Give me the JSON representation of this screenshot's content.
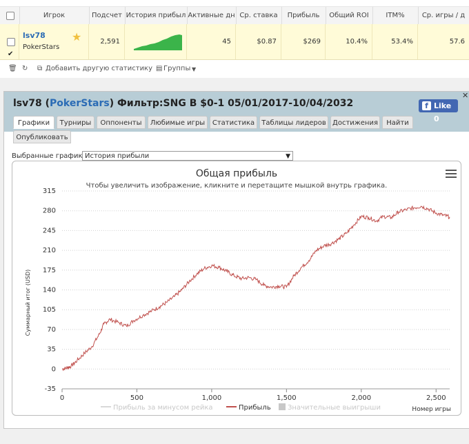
{
  "table": {
    "headers": [
      "Игрок",
      "Подсчет",
      "История прибыл",
      "Активные дн",
      "Ср. ставка",
      "Прибыль",
      "Общий ROI",
      "ITM%",
      "Ср. игры / д"
    ],
    "row": {
      "checked": true,
      "name": "lsv78",
      "site": "PokerStars",
      "count": "2,591",
      "active_days": "45",
      "avg_stake": "$0.87",
      "profit": "$269",
      "roi": "10.4%",
      "itm": "53.4%",
      "avg_games": "57.6"
    },
    "toolbar": {
      "add_label": "Добавить другую статистику",
      "groups_label": "Группы"
    }
  },
  "panel": {
    "title_player": "lsv78",
    "title_site": "PokerStars",
    "title_filter": "Фильтр:SNG B $0-1 05/01/2017-10/04/2032",
    "like_label": "Like 0",
    "tabs": [
      "Графики",
      "Турниры",
      "Оппоненты",
      "Любимые игры",
      "Статистика",
      "Таблицы лидеров",
      "Достижения",
      "Найти",
      "Опубликовать"
    ],
    "active_tab": "Графики",
    "select_label": "Выбранные графики:",
    "select_value": "История прибыли"
  },
  "chart_data": {
    "type": "line",
    "title": "Общая прибыль",
    "subtitle": "Чтобы увеличить изображение, кликните и перетащите мышкой внутрь графика.",
    "ylabel": "Суммарный итог (USD)",
    "xlabel": "Номер игры",
    "ylim": [
      -35,
      315
    ],
    "xlim": [
      0,
      2591
    ],
    "yticks": [
      -35,
      0,
      35,
      70,
      105,
      140,
      175,
      210,
      245,
      280,
      315
    ],
    "xticks": [
      0,
      500,
      1000,
      1500,
      2000,
      2500
    ],
    "xtick_labels": [
      "0",
      "500",
      "1,000",
      "1,500",
      "2,000",
      "2,500"
    ],
    "legend": [
      "Прибыль за минусом рейка",
      "Прибыль",
      "Значительные выигрыши"
    ],
    "series": [
      {
        "name": "Прибыль",
        "color": "#c0504d",
        "x": [
          0,
          30,
          60,
          100,
          150,
          200,
          250,
          280,
          320,
          380,
          430,
          480,
          540,
          600,
          650,
          700,
          750,
          800,
          850,
          900,
          950,
          1000,
          1050,
          1100,
          1150,
          1200,
          1250,
          1300,
          1350,
          1400,
          1450,
          1500,
          1550,
          1600,
          1650,
          1700,
          1750,
          1800,
          1850,
          1900,
          1950,
          2000,
          2050,
          2100,
          2150,
          2200,
          2250,
          2300,
          2350,
          2400,
          2450,
          2500,
          2550,
          2591
        ],
        "y": [
          0,
          2,
          5,
          15,
          28,
          40,
          62,
          80,
          88,
          82,
          76,
          86,
          95,
          103,
          110,
          118,
          128,
          140,
          155,
          168,
          178,
          183,
          180,
          173,
          165,
          160,
          162,
          158,
          148,
          145,
          147,
          145,
          165,
          180,
          192,
          210,
          218,
          222,
          230,
          240,
          255,
          270,
          268,
          262,
          270,
          268,
          278,
          282,
          285,
          288,
          283,
          276,
          272,
          269
        ]
      }
    ]
  }
}
